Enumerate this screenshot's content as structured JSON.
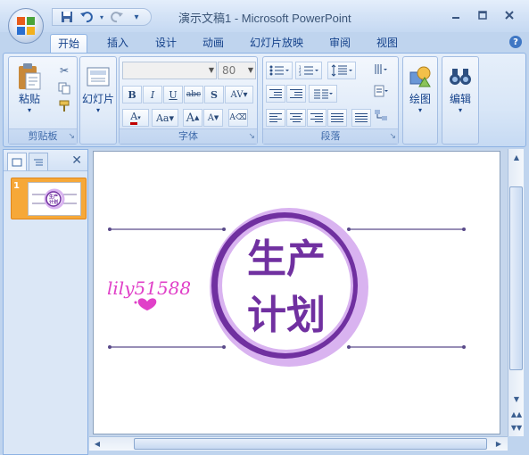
{
  "window": {
    "title": "演示文稿1 - Microsoft PowerPoint"
  },
  "quick_access": {
    "icons": [
      "save-icon",
      "undo-icon",
      "redo-icon",
      "customize-icon"
    ]
  },
  "tabs": [
    "开始",
    "插入",
    "设计",
    "动画",
    "幻灯片放映",
    "审阅",
    "视图"
  ],
  "ribbon": {
    "clipboard": {
      "paste_label": "粘贴",
      "group_label": "剪贴板"
    },
    "slides": {
      "new_slide_label": "幻灯片"
    },
    "font": {
      "font_name": "",
      "font_size": "80",
      "group_label": "字体"
    },
    "paragraph": {
      "group_label": "段落"
    },
    "drawing": {
      "label": "绘图"
    },
    "editing": {
      "label": "编辑"
    }
  },
  "left_pane": {
    "slide_number": "1"
  },
  "slide": {
    "title_line1": "生产",
    "title_line2": "计划",
    "watermark": "lily51588",
    "colors": {
      "dark_purple": "#7030a0",
      "light_purple": "#d9b3f0",
      "line": "#5a4a8a",
      "watermark": "#e040c8"
    }
  }
}
